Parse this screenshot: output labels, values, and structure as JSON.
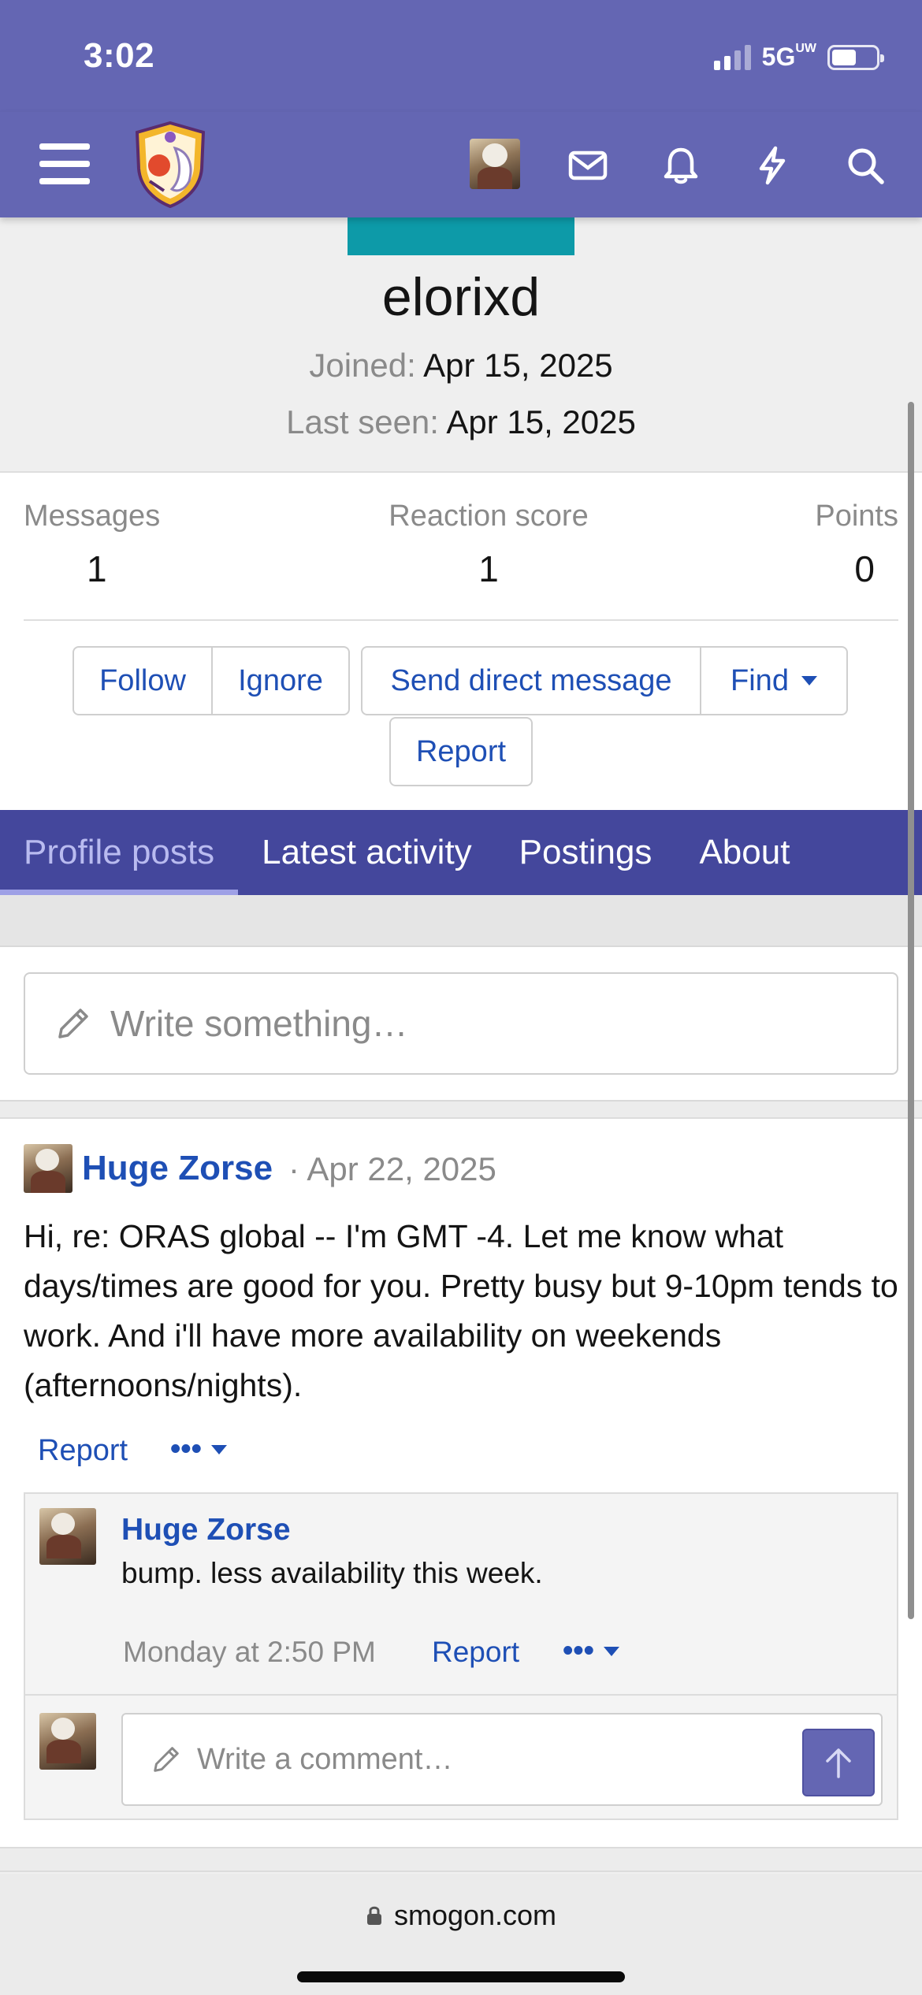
{
  "status_bar": {
    "time": "3:02",
    "network": "5G",
    "network_superscript": "UW"
  },
  "header": {
    "icons": [
      "menu-icon",
      "site-logo",
      "user-avatar",
      "inbox-icon",
      "alerts-icon",
      "whats-new-icon",
      "search-icon"
    ],
    "accent_color": "#6466b3"
  },
  "profile": {
    "username": "elorixd",
    "joined_label": "Joined:",
    "joined_value": "Apr 15, 2025",
    "last_seen_label": "Last seen:",
    "last_seen_value": "Apr 15, 2025",
    "banner_color": "#0d9aa8"
  },
  "stats": [
    {
      "label": "Messages",
      "value": "1"
    },
    {
      "label": "Reaction score",
      "value": "1"
    },
    {
      "label": "Points",
      "value": "0"
    }
  ],
  "actions": {
    "follow": "Follow",
    "ignore": "Ignore",
    "send_dm": "Send direct message",
    "find": "Find",
    "report": "Report"
  },
  "tabs": [
    {
      "label": "Profile posts",
      "active": true
    },
    {
      "label": "Latest activity",
      "active": false
    },
    {
      "label": "Postings",
      "active": false
    },
    {
      "label": "About",
      "active": false
    }
  ],
  "composer": {
    "placeholder": "Write something…"
  },
  "post": {
    "author": "Huge Zorse",
    "separator": "·",
    "date": "Apr 22, 2025",
    "body": "Hi, re: ORAS global -- I'm GMT -4. Let me know what days/times are good for you. Pretty busy but 9-10pm tends to work. And i'll have more availability on weekends (afternoons/nights).",
    "report": "Report",
    "more": "•••",
    "comment": {
      "author": "Huge Zorse",
      "text": "bump. less availability this week.",
      "time": "Monday at 2:50 PM",
      "report": "Report",
      "more": "•••"
    },
    "reply_placeholder": "Write a comment…"
  },
  "browser": {
    "url": "smogon.com"
  }
}
